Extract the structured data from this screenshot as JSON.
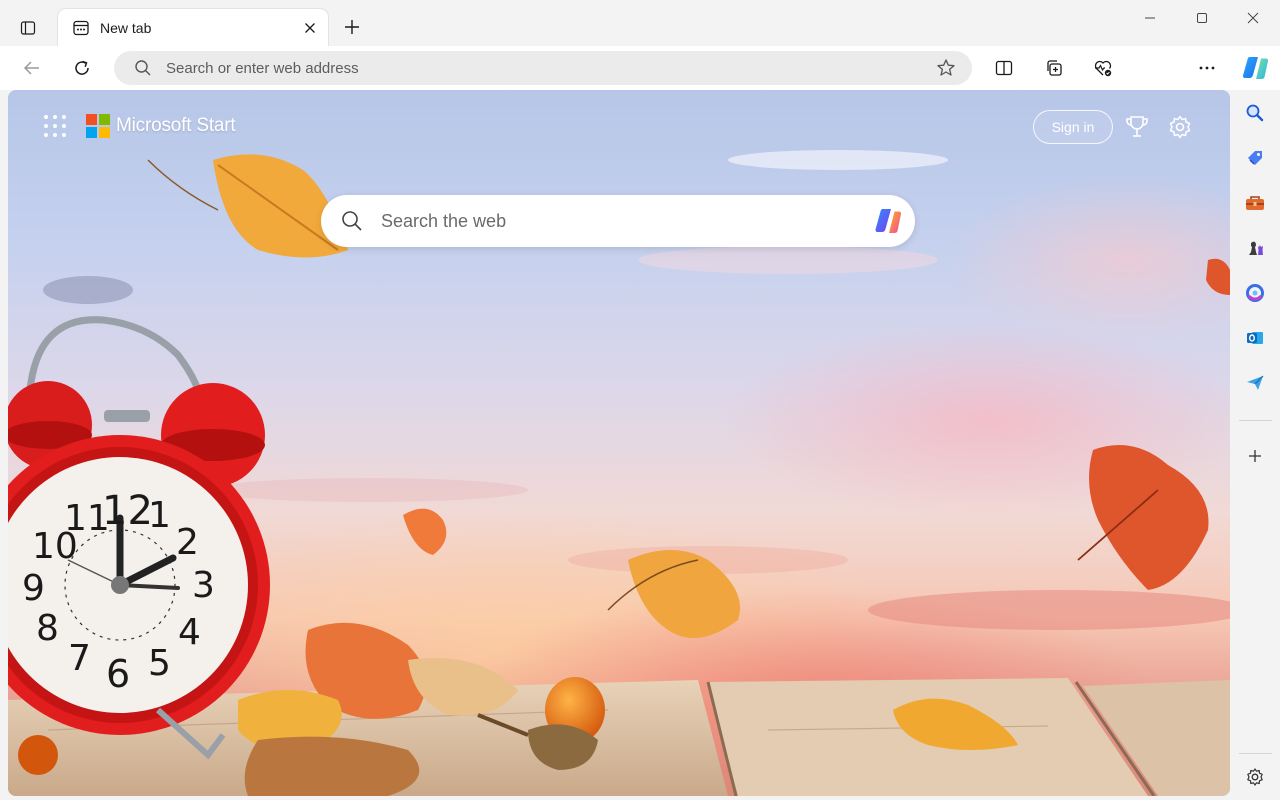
{
  "browser": {
    "tab": {
      "title": "New tab"
    },
    "address_bar": {
      "placeholder": "Search or enter web address"
    }
  },
  "page": {
    "brand": "Microsoft Start",
    "sign_in_label": "Sign in",
    "search": {
      "placeholder": "Search the web"
    }
  },
  "clock": {
    "numerals": [
      "12",
      "1",
      "2",
      "3",
      "4",
      "5",
      "6",
      "7",
      "8",
      "9",
      "10",
      "11"
    ]
  },
  "colors": {
    "accent": "#0067c0",
    "clock_red": "#e11d1d",
    "ms_red": "#f25022",
    "ms_green": "#7fba00",
    "ms_blue": "#00a4ef",
    "ms_yellow": "#ffb900"
  },
  "icons": {
    "tab_actions": "tab-actions-icon",
    "tab_favicon": "new-tab-page-icon",
    "sidebar": [
      "search-icon",
      "tag-icon",
      "toolbox-icon",
      "chess-icon",
      "microsoft365-icon",
      "outlook-icon",
      "send-icon",
      "add-icon",
      "settings-icon"
    ]
  }
}
